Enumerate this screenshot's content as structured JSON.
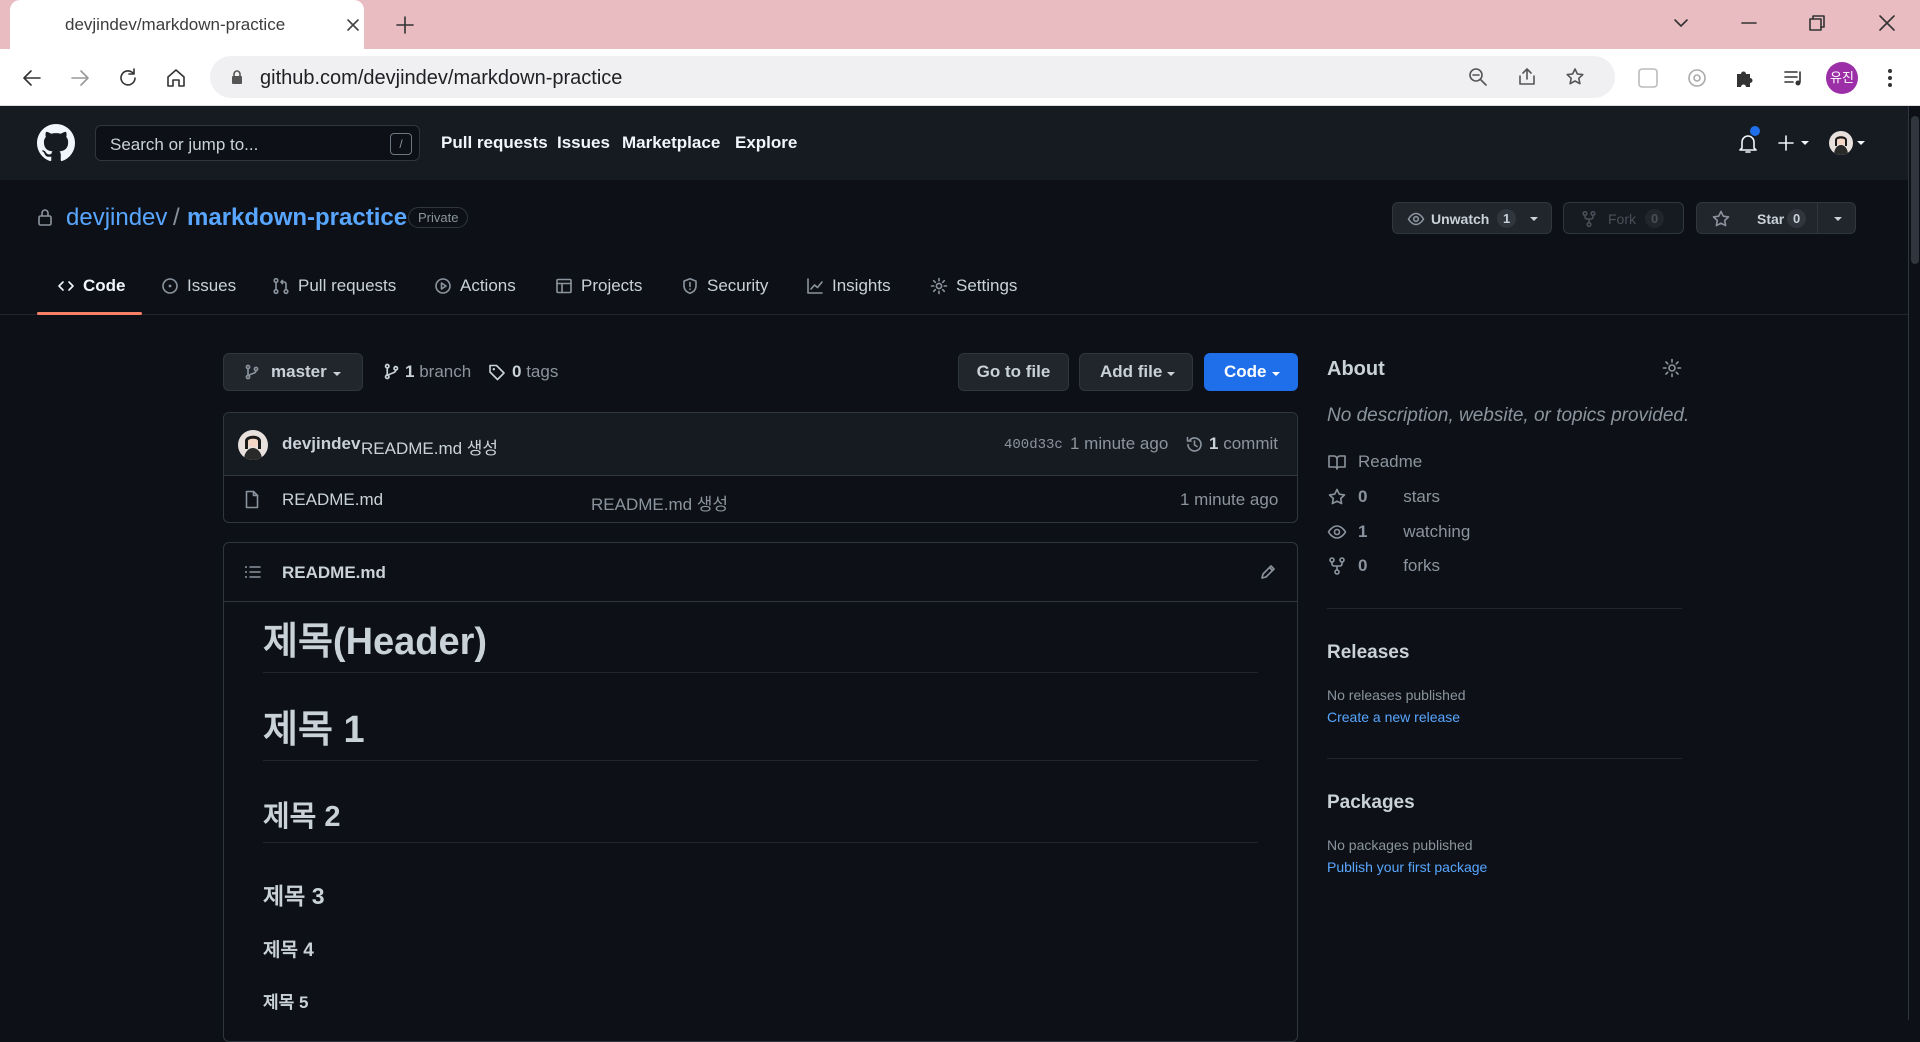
{
  "browser": {
    "tab_title": "devjindev/markdown-practice",
    "url": "github.com/devjindev/markdown-practice",
    "profile_initials": "유진"
  },
  "github_header": {
    "search_placeholder": "Search or jump to...",
    "slash_key": "/",
    "nav": [
      "Pull requests",
      "Issues",
      "Marketplace",
      "Explore"
    ]
  },
  "repo": {
    "owner": "devjindev",
    "separator": "/",
    "name": "markdown-practice",
    "visibility": "Private",
    "unwatch_label": "Unwatch",
    "watch_count": "1",
    "fork_label": "Fork",
    "fork_count": "0",
    "star_label": "Star",
    "star_count": "0",
    "tabs": [
      "Code",
      "Issues",
      "Pull requests",
      "Actions",
      "Projects",
      "Security",
      "Insights",
      "Settings"
    ],
    "active_tab": "Code"
  },
  "toolbar": {
    "branch": "master",
    "branch_count": "1",
    "branch_label": "branch",
    "tag_count": "0",
    "tag_label": "tags",
    "go_to_file": "Go to file",
    "add_file": "Add file",
    "code": "Code"
  },
  "latest_commit": {
    "author": "devjindev",
    "message": "README.md 생성",
    "sha": "400d33c",
    "time": "1 minute ago",
    "commit_count": "1",
    "commit_label": "commit"
  },
  "files": [
    {
      "name": "README.md",
      "message": "README.md 생성",
      "time": "1 minute ago"
    }
  ],
  "readme": {
    "filename": "README.md",
    "h_main": "제목(Header)",
    "h1": "제목 1",
    "h2": "제목 2",
    "h3": "제목 3",
    "h4": "제목 4",
    "h5": "제목 5"
  },
  "sidebar": {
    "about_title": "About",
    "about_desc": "No description, website, or topics provided.",
    "readme": "Readme",
    "stars_count": "0",
    "stars_label": "stars",
    "watching_count": "1",
    "watching_label": "watching",
    "forks_count": "0",
    "forks_label": "forks",
    "releases_title": "Releases",
    "releases_none": "No releases published",
    "releases_link": "Create a new release",
    "packages_title": "Packages",
    "packages_none": "No packages published",
    "packages_link": "Publish your first package"
  },
  "colors": {
    "background": "#0d1117",
    "header": "#161b22",
    "link": "#58a6ff",
    "primary_button": "#1f6feb",
    "active_tab_underline": "#f78166",
    "tabstrip": "#e8bcc0"
  }
}
